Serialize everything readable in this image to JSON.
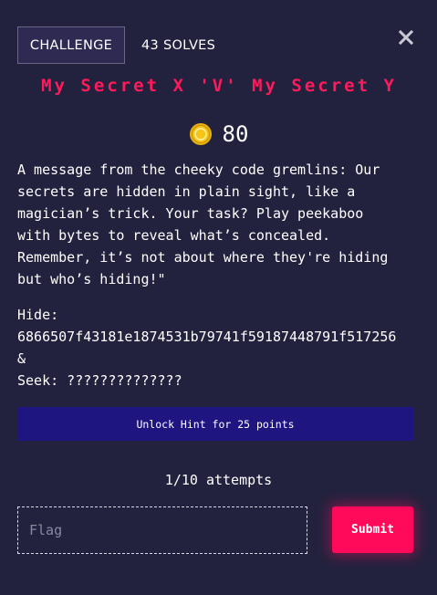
{
  "header": {
    "challenge_tab": "CHALLENGE",
    "solves": "43 SOLVES",
    "close_icon": "close-icon"
  },
  "challenge": {
    "title": "My Secret X 'V' My Secret Y",
    "points": "80",
    "points_icon": "coin-icon",
    "description": "A message from the cheeky code gremlins: Our\nsecrets are hidden in plain sight, like a\nmagician’s trick. Your task? Play peekaboo\nwith bytes to reveal what’s concealed.\nRemember, it’s not about where they're hiding\nbut who’s hiding!\"",
    "hide_label": "Hide:",
    "hide_value": "6866507f43181e1874531b79741f59187448791f517256",
    "ampersand": "&",
    "seek": "Seek: ??????????????"
  },
  "hint": {
    "button_label": "Unlock Hint for 25 points"
  },
  "attempts": "1/10 attempts",
  "form": {
    "flag_placeholder": "Flag",
    "flag_value": "",
    "submit_label": "Submit"
  },
  "colors": {
    "background": "#23223e",
    "accent": "#ff1a5c",
    "hint_button": "#1f1581",
    "submit_button": "#ff0a5a",
    "coin": "#f5c518"
  }
}
